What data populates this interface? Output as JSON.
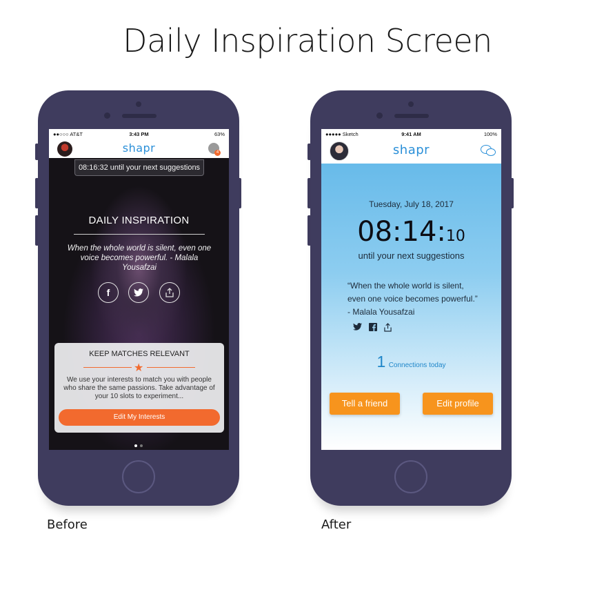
{
  "page": {
    "title": "Daily Inspiration Screen"
  },
  "captions": {
    "before": "Before",
    "after": "After"
  },
  "before": {
    "status": {
      "carrier": "●●○○○ AT&T",
      "time": "3:43 PM",
      "battery": "63%"
    },
    "logo": "shapr",
    "chat_badge": "4",
    "timer": "08:16:32 until your next suggestions",
    "heading": "DAILY INSPIRATION",
    "quote": "When the whole world is silent, even one voice becomes powerful. - Malala Yousafzai",
    "share": {
      "facebook": "f",
      "twitter": "🐦",
      "share": "⇧"
    },
    "card": {
      "title": "KEEP MATCHES RELEVANT",
      "body": "We use your interests to match you with people who share the same passions. Take advantage of your 10 slots to experiment...",
      "button": "Edit My Interests"
    },
    "icons": [
      "avatar",
      "chat-icon",
      "facebook-icon",
      "twitter-icon",
      "share-icon",
      "star-icon"
    ],
    "colors": {
      "accent": "#f26a2e",
      "brand": "#2a8fd8"
    }
  },
  "after": {
    "status": {
      "carrier": "●●●●● Sketch",
      "time": "9:41 AM",
      "battery": "100%"
    },
    "logo": "shapr",
    "date": "Tuesday, July 18, 2017",
    "clock_main": "08:14:",
    "clock_seconds": "10",
    "subtitle": "until your next suggestions",
    "quote_line1": "“When the whole world is silent,",
    "quote_line2": "even one voice becomes powerful.”",
    "quote_line3": "- Malala Yousafzai",
    "connections_count": "1",
    "connections_label": "Connections today",
    "buttons": {
      "tell_friend": "Tell a friend",
      "edit_profile": "Edit profile"
    },
    "icons": [
      "avatar",
      "chat-icon",
      "twitter-icon",
      "facebook-icon",
      "share-icon"
    ],
    "colors": {
      "button": "#f7941d",
      "brand": "#2a8fd8",
      "gradient_top": "#5cb5e8"
    }
  }
}
